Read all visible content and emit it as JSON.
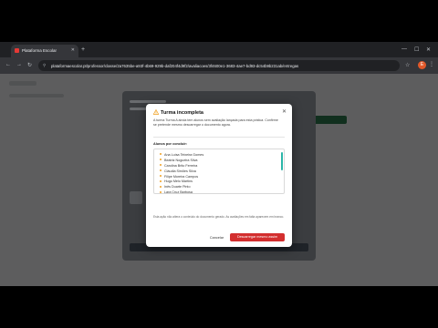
{
  "browser": {
    "tab_title": "Plataforma Escolar",
    "url": "plataformaescolar.pt/professor/classe/2a7635be-a93f-4b69-929b-daf204f4d9f2/avaliacoes/3f4600e1-3683-4ae7-bd93-dc54b9b231ab/entregas",
    "profile_initial": "E"
  },
  "modal": {
    "title": "Turma incompleta",
    "description": "A turma Turma A ainda tem alunos sem avaliação lançada para esta prática. Confirme se pretende mesmo descarregar o documento agora.",
    "list_label": "Alunos por concluir:",
    "students": [
      "Ana Luísa Teixeira Gomes",
      "Beatriz Nogueira Silva",
      "Carolina Brito Ferreira",
      "Cláudia Simões Silva",
      "Filipe Moreira Campos",
      "Hugo Melo Martins",
      "Inês Duarte Pinto",
      "Lara Cruz Barbosa"
    ],
    "note": "Esta ação não altera o conteúdo do documento gerado. As avaliações em falta aparecem em branco.",
    "cancel_label": "Cancelar",
    "confirm_label": "Descarregar mesmo assim"
  },
  "colors": {
    "accent": "#d32f2f",
    "warning": "#f0a020",
    "scroll": "#2bb5a8"
  }
}
